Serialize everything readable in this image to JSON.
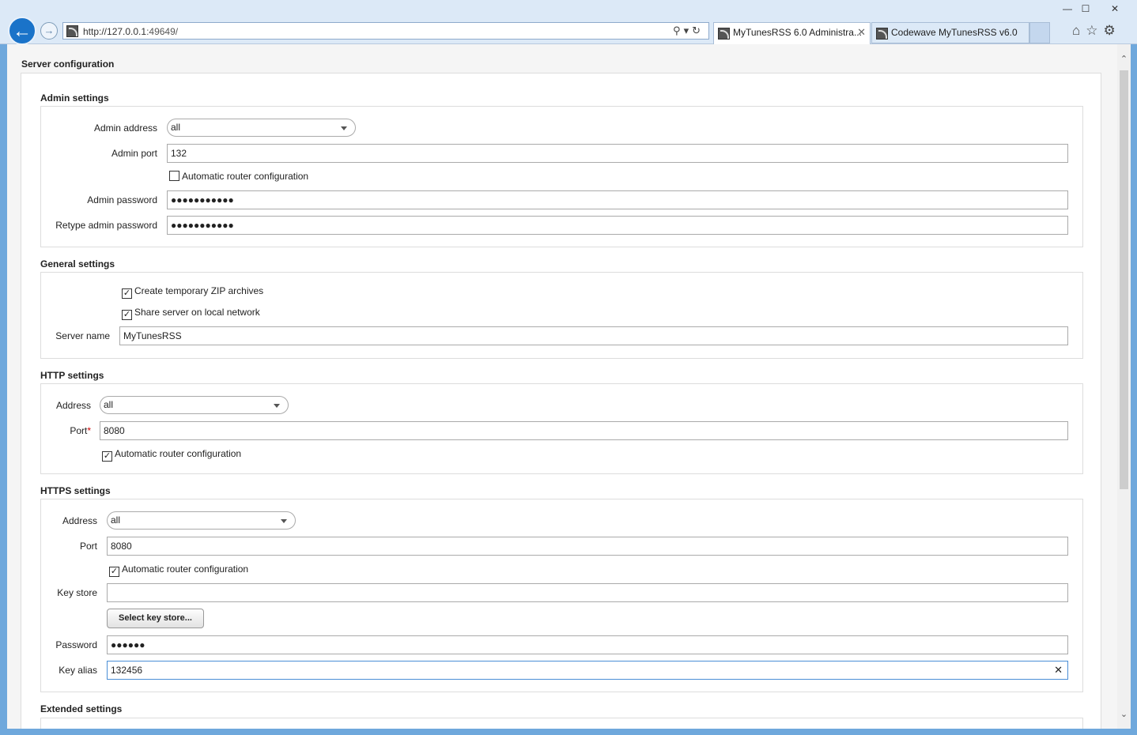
{
  "browser": {
    "url_host": "http://127.0.0.1",
    "url_port": ":49649/",
    "tabs": [
      {
        "label": "MyTunesRSS 6.0 Administra...",
        "active": true
      },
      {
        "label": "Codewave MyTunesRSS v6.0",
        "active": false
      }
    ],
    "window_controls": {
      "minimize": "—",
      "maximize": "☐",
      "close": "✕"
    },
    "icons": [
      "back-arrow-icon",
      "forward-arrow-icon",
      "search-icon",
      "refresh-icon",
      "home-icon",
      "star-icon",
      "gear-icon"
    ]
  },
  "page": {
    "title": "Server configuration"
  },
  "admin": {
    "title": "Admin settings",
    "address_label": "Admin address",
    "address_value": "all",
    "port_label": "Admin port",
    "port_value": "132",
    "auto_router_label": "Automatic router configuration",
    "auto_router_checked": false,
    "password_label": "Admin password",
    "password_value": "●●●●●●●●●●●",
    "retype_label": "Retype admin password",
    "retype_value": "●●●●●●●●●●●"
  },
  "general": {
    "title": "General settings",
    "zip_label": "Create temporary ZIP archives",
    "zip_checked": true,
    "share_label": "Share server on local network",
    "share_checked": true,
    "server_name_label": "Server name",
    "server_name_value": "MyTunesRSS"
  },
  "http": {
    "title": "HTTP settings",
    "address_label": "Address",
    "address_value": "all",
    "port_label": "Port",
    "port_required": "*",
    "port_value": "8080",
    "auto_router_label": "Automatic router configuration",
    "auto_router_checked": true
  },
  "https": {
    "title": "HTTPS settings",
    "address_label": "Address",
    "address_value": "all",
    "port_label": "Port",
    "port_value": "8080",
    "auto_router_label": "Automatic router configuration",
    "auto_router_checked": true,
    "keystore_label": "Key store",
    "keystore_value": "",
    "select_keystore_button": "Select key store...",
    "password_label": "Password",
    "password_value": "●●●●●●",
    "alias_label": "Key alias",
    "alias_value": "132456",
    "clear_glyph": "✕"
  },
  "extended": {
    "title": "Extended settings"
  },
  "check_glyph": "✓"
}
